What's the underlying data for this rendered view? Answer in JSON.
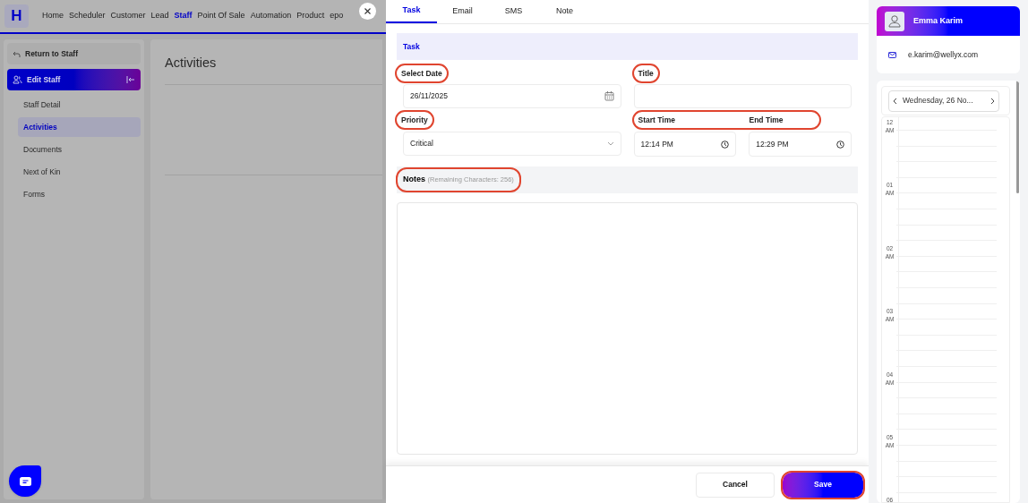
{
  "nav": {
    "logo": "H",
    "items": [
      {
        "label": "Home",
        "selected": false
      },
      {
        "label": "Scheduler",
        "selected": false
      },
      {
        "label": "Customer",
        "selected": false
      },
      {
        "label": "Lead",
        "selected": false
      },
      {
        "label": "Staff",
        "selected": true
      },
      {
        "label": "Point Of Sale",
        "selected": false
      },
      {
        "label": "Automation",
        "selected": false
      },
      {
        "label": "Product",
        "selected": false
      },
      {
        "label": "epo",
        "selected": false
      }
    ]
  },
  "sidebar": {
    "back": "Return to Staff",
    "section": "Edit Staff",
    "items": [
      {
        "label": "Staff Detail",
        "selected": false
      },
      {
        "label": "Activities",
        "selected": true
      },
      {
        "label": "Documents",
        "selected": false
      },
      {
        "label": "Next of Kin",
        "selected": false
      },
      {
        "label": "Forms",
        "selected": false
      }
    ]
  },
  "main": {
    "title": "Activities"
  },
  "drawer": {
    "tabs": [
      {
        "label": "Task",
        "selected": true
      },
      {
        "label": "Email",
        "selected": false
      },
      {
        "label": "SMS",
        "selected": false
      },
      {
        "label": "Note",
        "selected": false
      }
    ],
    "section_title": "Task",
    "select_date": {
      "label": "Select Date",
      "value": "26/11/2025",
      "highlighted": true
    },
    "title": {
      "label": "Title",
      "highlighted": true
    },
    "priority": {
      "label": "Priority",
      "value": "Critical",
      "highlighted": true
    },
    "times": {
      "highlighted": true,
      "start": {
        "label": "Start Time",
        "value": "12:14 PM"
      },
      "end": {
        "label": "End Time",
        "value": "12:29 PM"
      }
    },
    "notes": {
      "label": "Notes",
      "hint": "(Remaining Characters: 256)",
      "highlighted": true
    },
    "buttons": {
      "cancel": {
        "label": "Cancel"
      },
      "save": {
        "label": "Save",
        "highlighted": true
      }
    }
  },
  "contact": {
    "name": "Emma Karim",
    "email": "e.karim@wellyx.com"
  },
  "calendar": {
    "date": "Wednesday, 26 No...",
    "hours": [
      {
        "label": "12 AM"
      },
      {
        "label": "01 AM"
      },
      {
        "label": "02 AM"
      },
      {
        "label": "03 AM"
      },
      {
        "label": "04 AM"
      },
      {
        "label": "05 AM"
      },
      {
        "label": "06"
      }
    ]
  }
}
